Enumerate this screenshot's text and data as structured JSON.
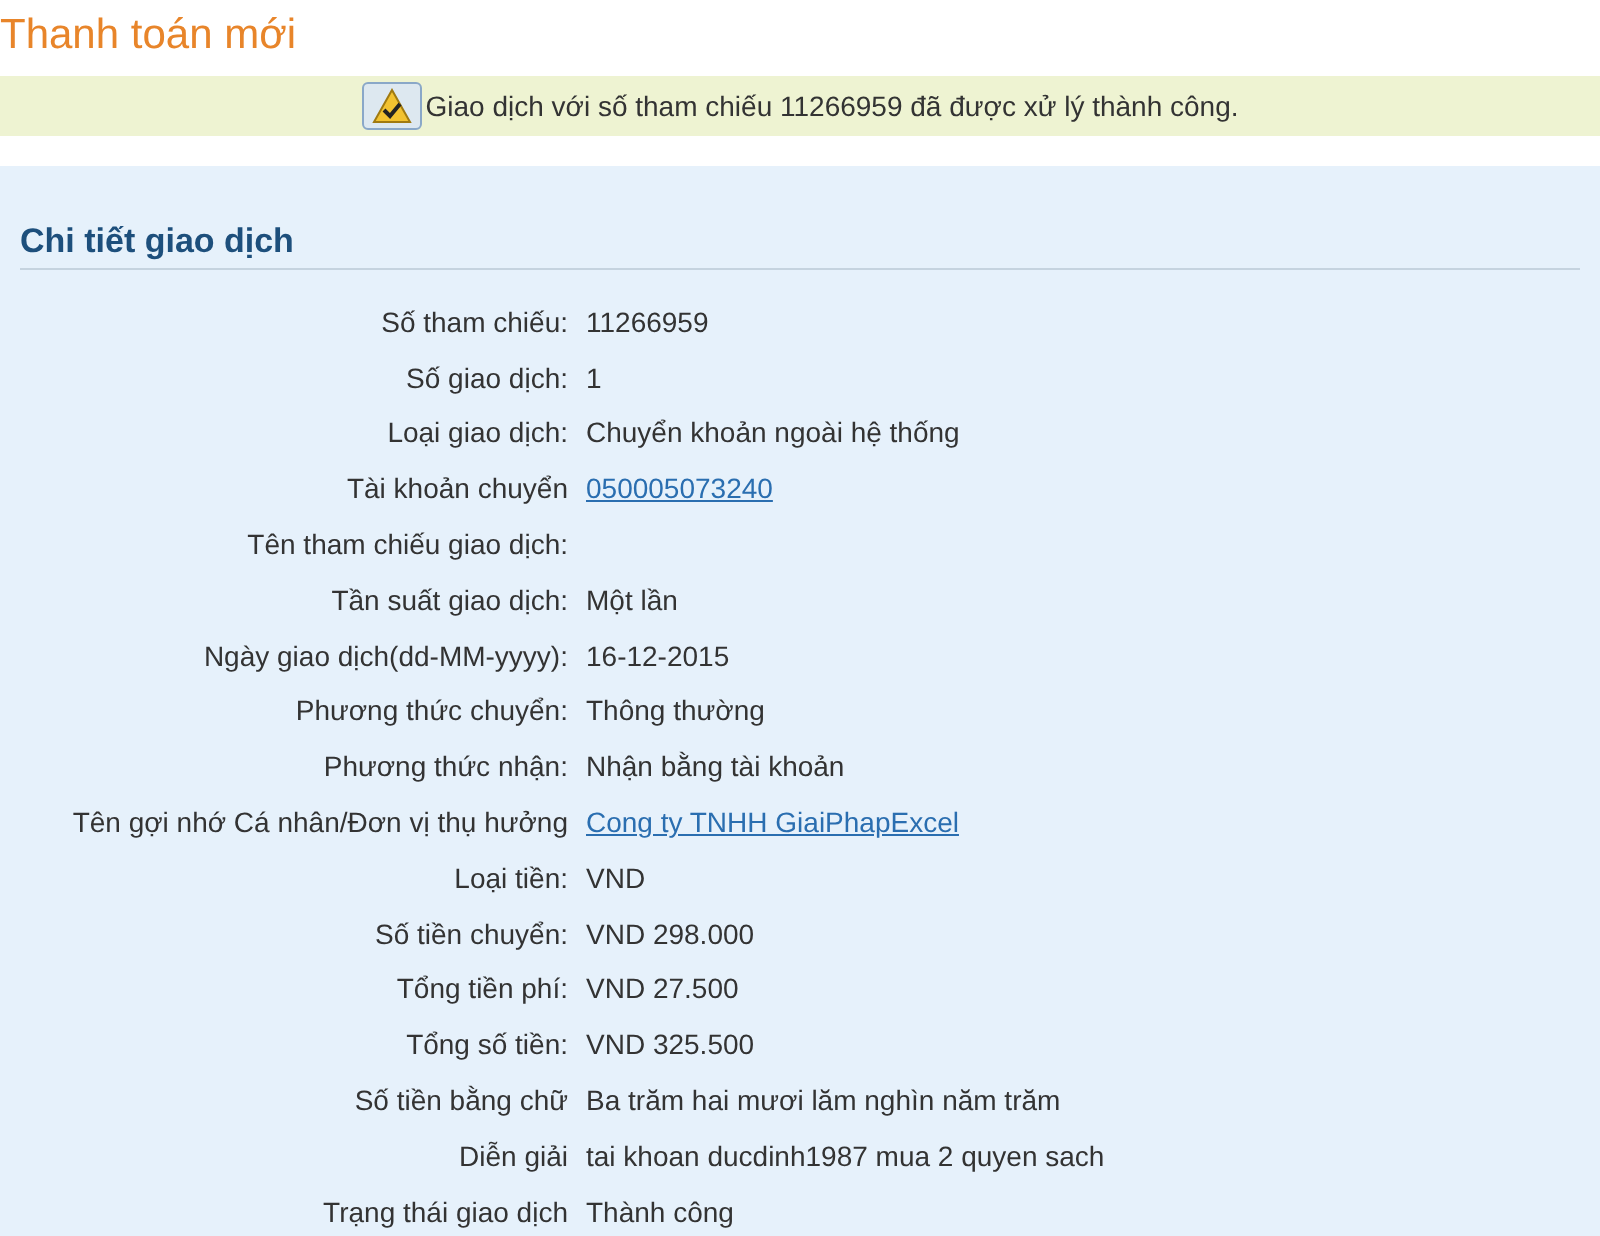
{
  "page_title": "Thanh toán mới",
  "notice": {
    "text": "Giao dịch với số tham chiếu 11266959 đã được xử lý thành công."
  },
  "section": {
    "title": "Chi tiết giao dịch",
    "rows": [
      {
        "label": "Số tham chiếu:",
        "value": "11266959",
        "kind": "text"
      },
      {
        "label": "Số giao dịch:",
        "value": "1",
        "kind": "text"
      },
      {
        "label": "Loại giao dịch:",
        "value": "Chuyển khoản ngoài hệ thống",
        "kind": "text"
      },
      {
        "label": "Tài khoản chuyển",
        "value": "050005073240",
        "kind": "link"
      },
      {
        "label": "Tên tham chiếu giao dịch:",
        "kind": "text"
      },
      {
        "label": "Tần suất giao dịch:",
        "value": "Một lần",
        "kind": "text"
      },
      {
        "label": "Ngày giao dịch(dd-MM-yyyy):",
        "value": "16-12-2015",
        "kind": "text"
      },
      {
        "label": "Phương thức chuyển:",
        "value": "Thông thường",
        "kind": "text"
      },
      {
        "label": "Phương thức nhận:",
        "value": "Nhận bằng tài khoản",
        "kind": "text"
      },
      {
        "label": "Tên gợi nhớ Cá nhân/Đơn vị thụ hưởng",
        "value": "Cong ty TNHH GiaiPhapExcel",
        "kind": "link"
      },
      {
        "label": "Loại tiền:",
        "value": "VND",
        "kind": "text"
      },
      {
        "label": "Số tiền chuyển:",
        "value": "VND 298.000",
        "kind": "text"
      },
      {
        "label": "Tổng tiền phí:",
        "value": "VND 27.500",
        "kind": "text"
      },
      {
        "label": "Tổng số tiền:",
        "value": "VND 325.500",
        "kind": "text"
      },
      {
        "label": "Số tiền bằng chữ",
        "value": "Ba trăm hai mươi lăm nghìn năm trăm",
        "kind": "text"
      },
      {
        "label": "Diễn giải",
        "value": "tai khoan ducdinh1987 mua 2 quyen sach",
        "kind": "text"
      },
      {
        "label": "Trạng thái giao dịch",
        "value": "Thành công",
        "kind": "text"
      }
    ]
  }
}
